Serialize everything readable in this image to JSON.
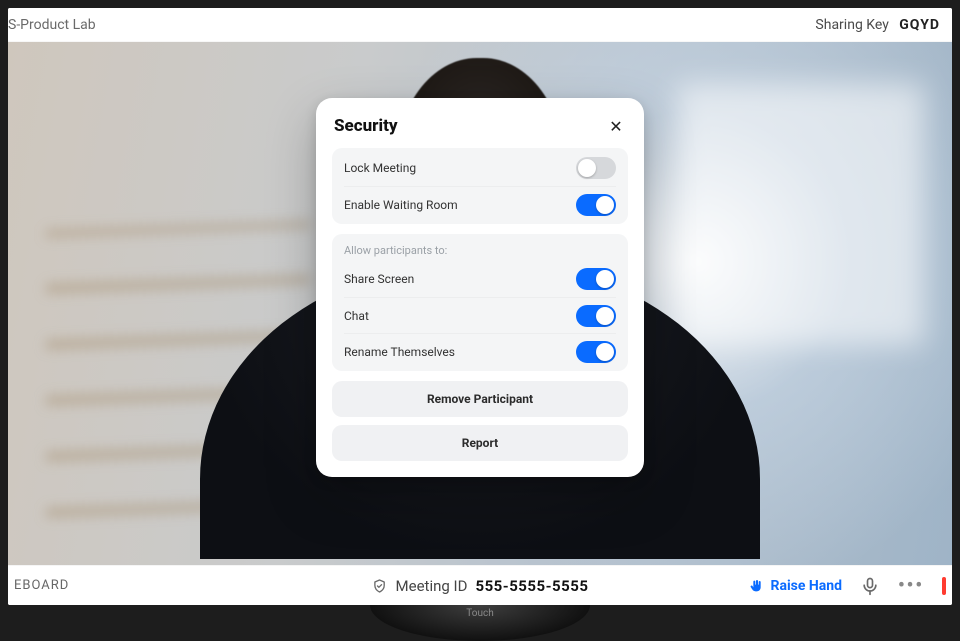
{
  "header": {
    "room_name": "S-Product Lab",
    "sharing_label": "Sharing Key",
    "sharing_key": "GQYD"
  },
  "footer": {
    "left_label": "EBOARD",
    "meeting_id_label": "Meeting ID",
    "meeting_id_value": "555-5555-5555",
    "raise_hand_label": "Raise Hand",
    "touch_label": "Touch"
  },
  "modal": {
    "title": "Security",
    "close_glyph": "✕",
    "options": {
      "lock_meeting": {
        "label": "Lock Meeting",
        "on": false
      },
      "waiting_room": {
        "label": "Enable Waiting Room",
        "on": true
      }
    },
    "allow_header": "Allow participants to:",
    "allow": {
      "share_screen": {
        "label": "Share Screen",
        "on": true
      },
      "chat": {
        "label": "Chat",
        "on": true
      },
      "rename": {
        "label": "Rename Themselves",
        "on": true
      }
    },
    "actions": {
      "remove": "Remove Participant",
      "report": "Report"
    }
  },
  "icons": {
    "hand": "✋",
    "mic": "mic",
    "more": "•••",
    "shield": "shield"
  }
}
